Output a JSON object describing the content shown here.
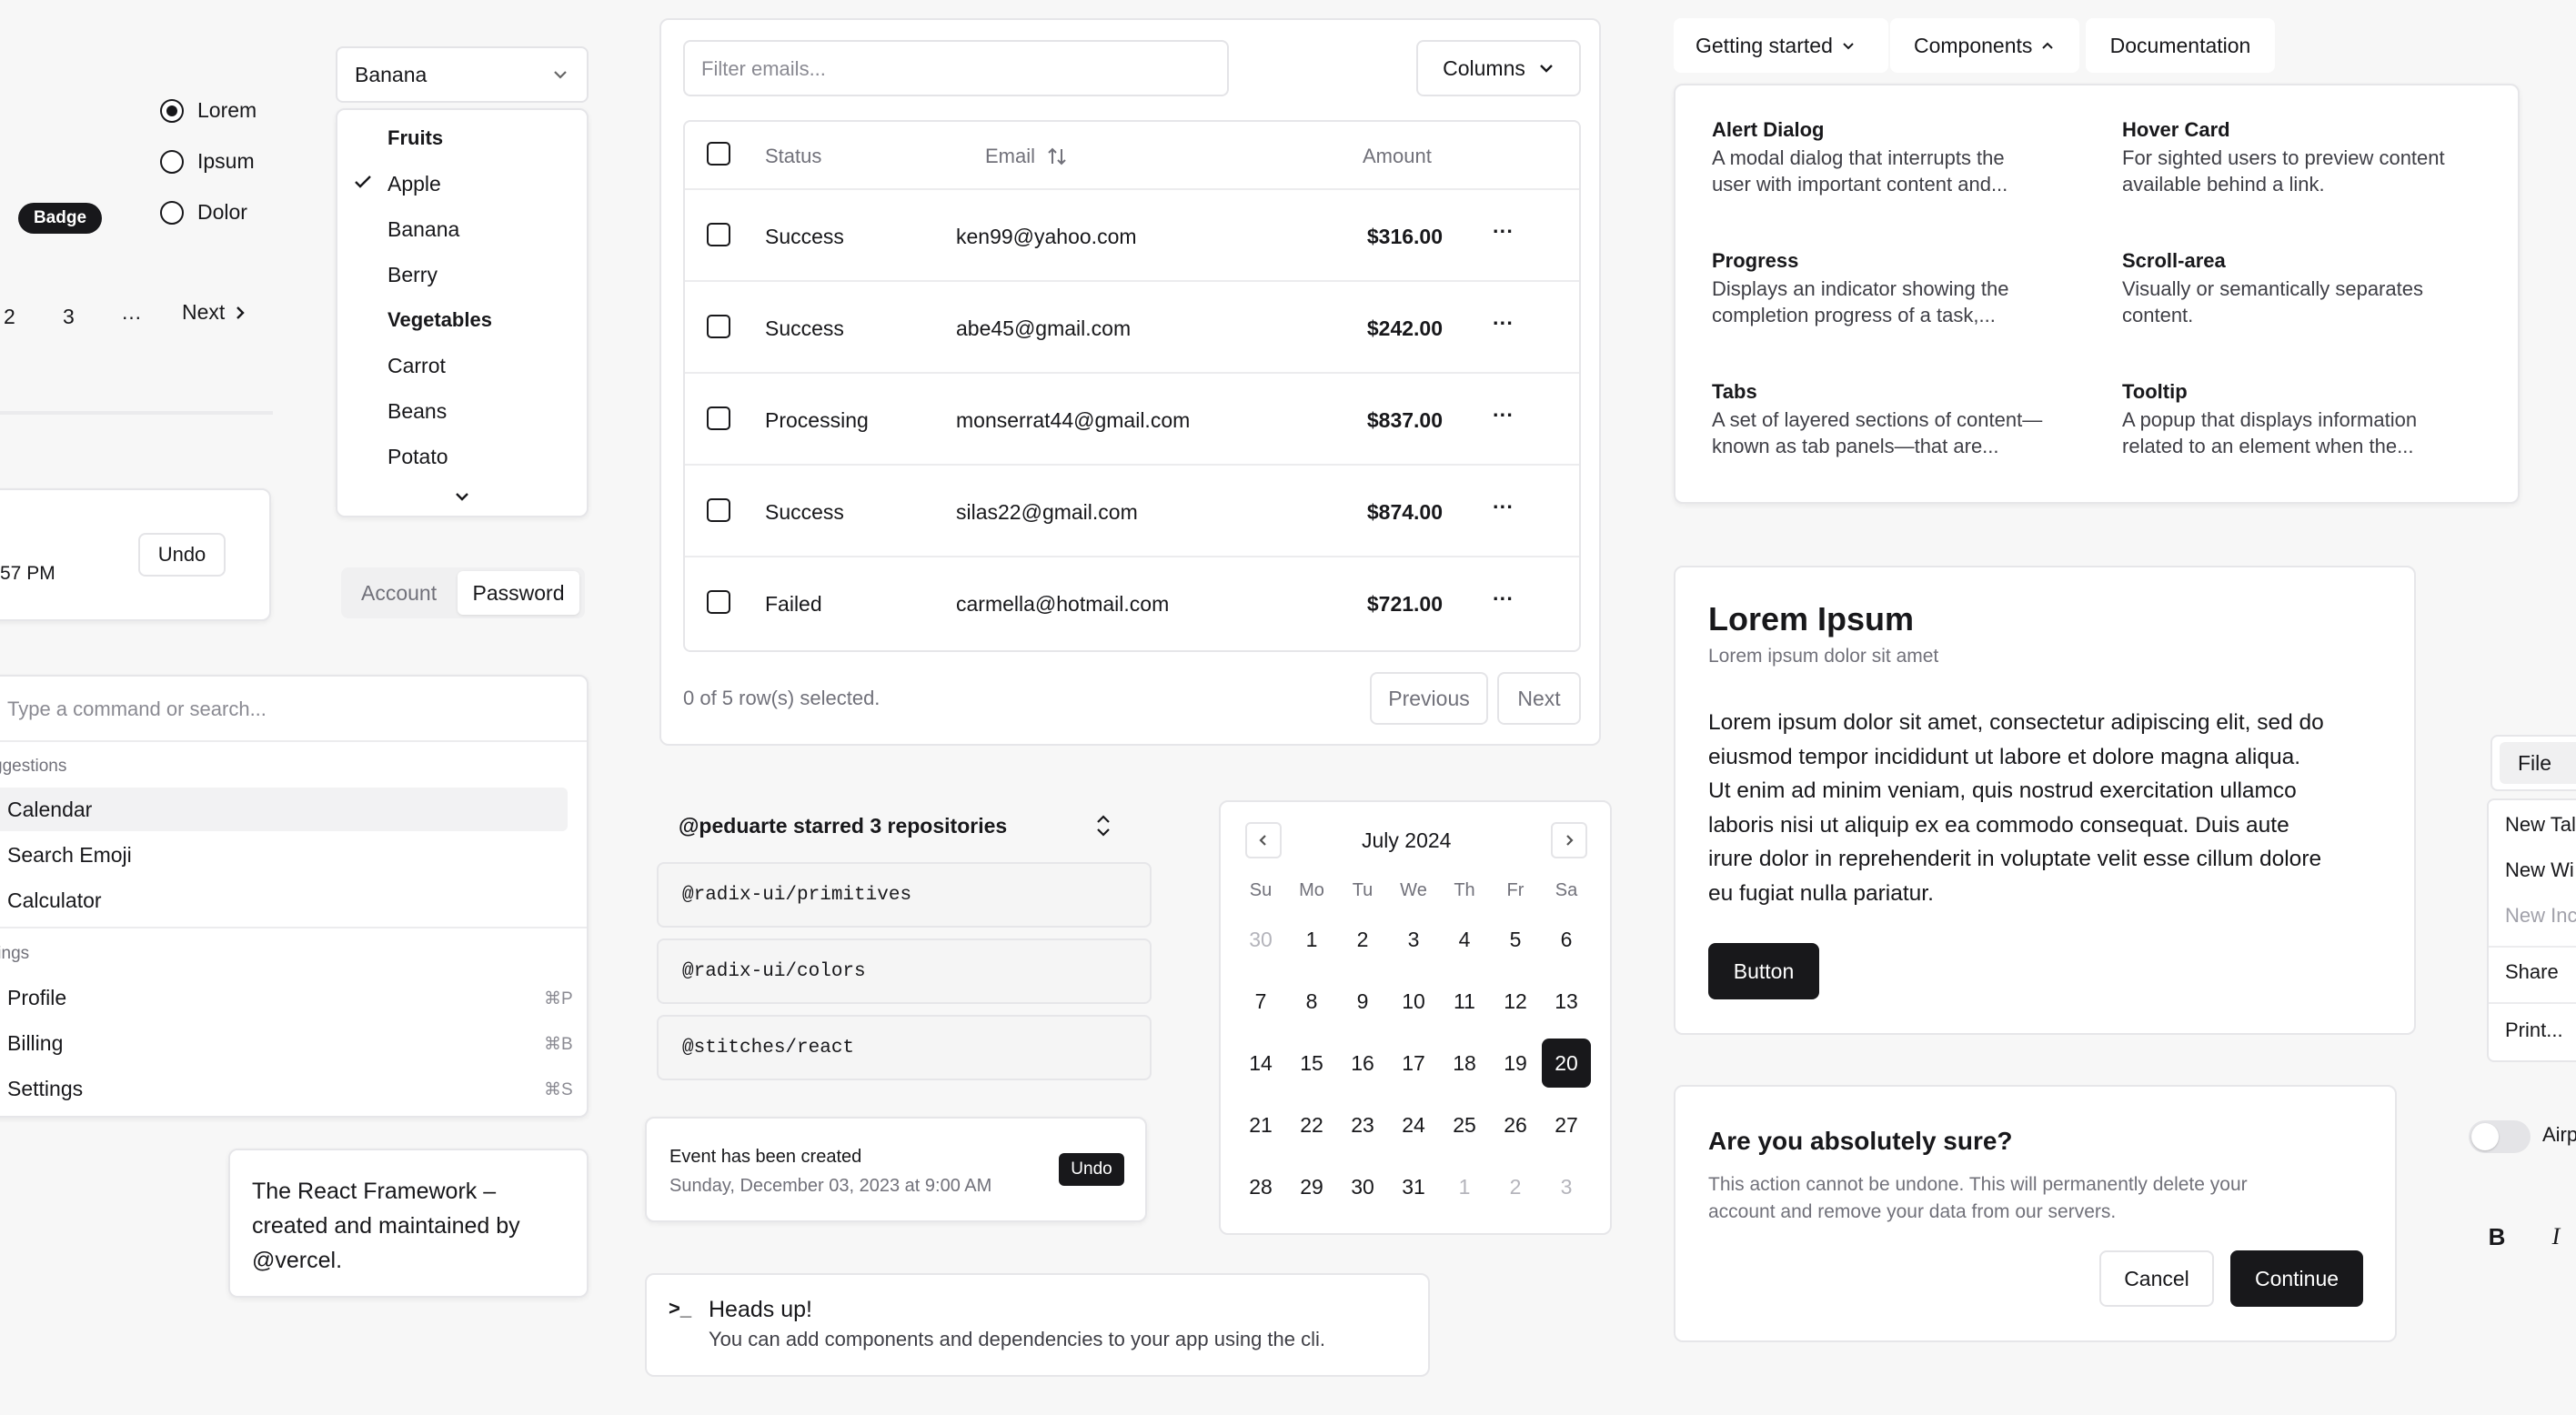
{
  "radio": {
    "items": [
      {
        "label": "Lorem",
        "checked": true
      },
      {
        "label": "Ipsum",
        "checked": false
      },
      {
        "label": "Dolor",
        "checked": false
      }
    ]
  },
  "badge": {
    "label": "Badge"
  },
  "pagination": {
    "visible_pages": [
      "2",
      "3"
    ],
    "ellipsis": "…",
    "next": "Next"
  },
  "select": {
    "value": "Banana",
    "groups": [
      {
        "label": "Fruits",
        "items": [
          "Apple",
          "Banana",
          "Berry"
        ]
      },
      {
        "label": "Vegetables",
        "items": [
          "Carrot",
          "Beans",
          "Potato"
        ]
      }
    ],
    "checked_item": "Apple"
  },
  "toast_partial": {
    "time_text": "57 PM",
    "undo": "Undo"
  },
  "tabs_small": {
    "items": [
      "Account",
      "Password"
    ],
    "active": "Password"
  },
  "command": {
    "placeholder": "Type a command or search...",
    "groups": [
      {
        "label": "ggestions",
        "items": [
          {
            "label": "Calendar"
          },
          {
            "label": "Search Emoji"
          },
          {
            "label": "Calculator"
          }
        ]
      },
      {
        "label": "tings",
        "items": [
          {
            "label": "Profile",
            "shortcut": "⌘P"
          },
          {
            "label": "Billing",
            "shortcut": "⌘B"
          },
          {
            "label": "Settings",
            "shortcut": "⌘S"
          }
        ]
      }
    ]
  },
  "hovercard": {
    "text": "The React Framework – created and maintained by @vercel."
  },
  "table": {
    "filter_placeholder": "Filter emails...",
    "columns_button": "Columns",
    "headers": {
      "status": "Status",
      "email": "Email",
      "amount": "Amount"
    },
    "rows": [
      {
        "status": "Success",
        "email": "ken99@yahoo.com",
        "amount": "$316.00"
      },
      {
        "status": "Success",
        "email": "abe45@gmail.com",
        "amount": "$242.00"
      },
      {
        "status": "Processing",
        "email": "monserrat44@gmail.com",
        "amount": "$837.00"
      },
      {
        "status": "Success",
        "email": "silas22@gmail.com",
        "amount": "$874.00"
      },
      {
        "status": "Failed",
        "email": "carmella@hotmail.com",
        "amount": "$721.00"
      }
    ],
    "row_action": "···",
    "selection_text": "0 of 5 row(s) selected.",
    "previous": "Previous",
    "next": "Next"
  },
  "collapsible": {
    "title": "@peduarte starred 3 repositories",
    "repos": [
      "@radix-ui/primitives",
      "@radix-ui/colors",
      "@stitches/react"
    ]
  },
  "toast": {
    "title": "Event has been created",
    "description": "Sunday, December 03, 2023 at 9:00 AM",
    "action": "Undo"
  },
  "alert": {
    "icon": ">_",
    "title": "Heads up!",
    "description": "You can add components and dependencies to your app using the cli."
  },
  "calendar": {
    "month": "July 2024",
    "weekdays": [
      "Su",
      "Mo",
      "Tu",
      "We",
      "Th",
      "Fr",
      "Sa"
    ],
    "weeks": [
      [
        "30",
        "1",
        "2",
        "3",
        "4",
        "5",
        "6"
      ],
      [
        "7",
        "8",
        "9",
        "10",
        "11",
        "12",
        "13"
      ],
      [
        "14",
        "15",
        "16",
        "17",
        "18",
        "19",
        "20"
      ],
      [
        "21",
        "22",
        "23",
        "24",
        "25",
        "26",
        "27"
      ],
      [
        "28",
        "29",
        "30",
        "31",
        "1",
        "2",
        "3"
      ]
    ],
    "selected": "20"
  },
  "navmenu": {
    "items": [
      "Getting started",
      "Components",
      "Documentation"
    ],
    "open": "Components",
    "links": [
      {
        "title": "Alert Dialog",
        "desc1": "A modal dialog that interrupts the",
        "desc2": "user with important content and..."
      },
      {
        "title": "Hover Card",
        "desc1": "For sighted users to preview content",
        "desc2": "available behind a link."
      },
      {
        "title": "Progress",
        "desc1": "Displays an indicator showing the",
        "desc2": "completion progress of a task,..."
      },
      {
        "title": "Scroll-area",
        "desc1": "Visually or semantically separates",
        "desc2": "content."
      },
      {
        "title": "Tabs",
        "desc1": "A set of layered sections of content—",
        "desc2": "known as tab panels—that are..."
      },
      {
        "title": "Tooltip",
        "desc1": "A popup that displays information",
        "desc2": "related to an element when the..."
      }
    ]
  },
  "card": {
    "title": "Lorem Ipsum",
    "description": "Lorem ipsum dolor sit amet",
    "body": [
      "Lorem ipsum dolor sit amet, consectetur adipiscing elit, sed do",
      "eiusmod tempor incididunt ut labore et dolore magna aliqua.",
      "Ut enim ad minim veniam, quis nostrud exercitation ullamco",
      "laboris nisi ut aliquip ex ea commodo consequat. Duis aute",
      "irure dolor in reprehenderit in voluptate velit esse cillum dolore",
      "eu fugiat nulla pariatur."
    ],
    "button": "Button"
  },
  "alert_dialog": {
    "title": "Are you absolutely sure?",
    "description1": "This action cannot be undone. This will permanently delete your",
    "description2": "account and remove your data from our servers.",
    "cancel": "Cancel",
    "continue": "Continue"
  },
  "menubar": {
    "trigger": "File",
    "items": [
      "New Tal",
      "New Wi",
      "New Inc",
      "Share",
      "Print..."
    ],
    "disabled_index": 2
  },
  "switch": {
    "label": "Airp",
    "on": false
  },
  "toggles": {
    "bold": "B",
    "italic": "I"
  }
}
